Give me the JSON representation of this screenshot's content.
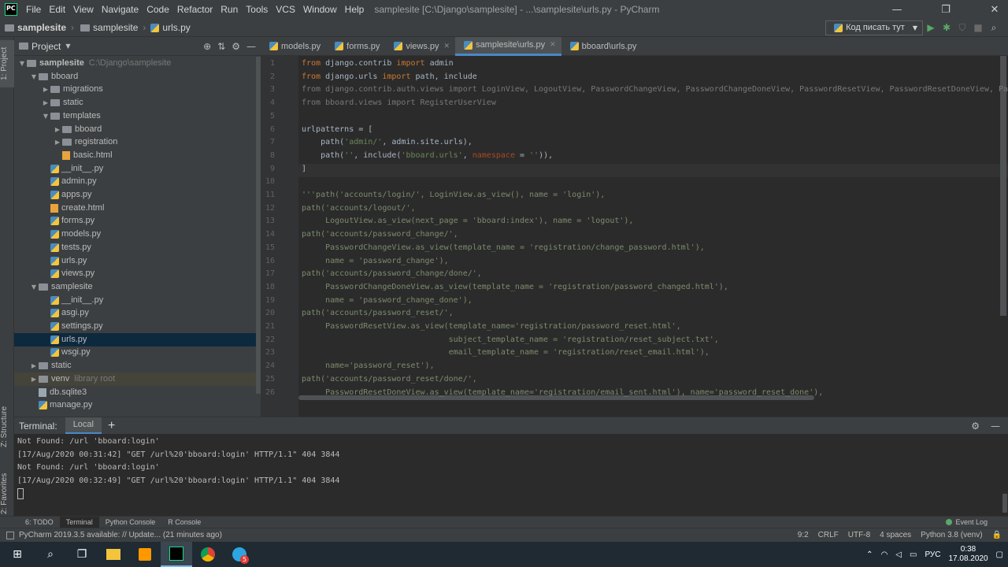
{
  "menu": [
    "File",
    "Edit",
    "View",
    "Navigate",
    "Code",
    "Refactor",
    "Run",
    "Tools",
    "VCS",
    "Window",
    "Help"
  ],
  "window_title": "samplesite [C:\\Django\\samplesite] - ...\\samplesite\\urls.py - PyCharm",
  "window_controls": {
    "minimize": "—",
    "maximize": "❐",
    "close": "✕"
  },
  "breadcrumbs": [
    "samplesite",
    "samplesite",
    "urls.py"
  ],
  "run_config": "Код писать тут",
  "left_strip": {
    "project": "1: Project",
    "structure": "Z: Structure",
    "favorites": "2: Favorites"
  },
  "project_panel": {
    "title": "Project"
  },
  "tree": [
    {
      "label": "samplesite",
      "extra": "C:\\Django\\samplesite",
      "depth": 0,
      "arrow": "▼",
      "type": "folder",
      "bold": true
    },
    {
      "label": "bboard",
      "depth": 1,
      "arrow": "▼",
      "type": "folder"
    },
    {
      "label": "migrations",
      "depth": 2,
      "arrow": "▶",
      "type": "folder"
    },
    {
      "label": "static",
      "depth": 2,
      "arrow": "▶",
      "type": "folder"
    },
    {
      "label": "templates",
      "depth": 2,
      "arrow": "▼",
      "type": "folder"
    },
    {
      "label": "bboard",
      "depth": 3,
      "arrow": "▶",
      "type": "folder"
    },
    {
      "label": "registration",
      "depth": 3,
      "arrow": "▶",
      "type": "folder"
    },
    {
      "label": "basic.html",
      "depth": 3,
      "arrow": "",
      "type": "html"
    },
    {
      "label": "__init__.py",
      "depth": 2,
      "arrow": "",
      "type": "py"
    },
    {
      "label": "admin.py",
      "depth": 2,
      "arrow": "",
      "type": "py"
    },
    {
      "label": "apps.py",
      "depth": 2,
      "arrow": "",
      "type": "py"
    },
    {
      "label": "create.html",
      "depth": 2,
      "arrow": "",
      "type": "html"
    },
    {
      "label": "forms.py",
      "depth": 2,
      "arrow": "",
      "type": "py"
    },
    {
      "label": "models.py",
      "depth": 2,
      "arrow": "",
      "type": "py"
    },
    {
      "label": "tests.py",
      "depth": 2,
      "arrow": "",
      "type": "py"
    },
    {
      "label": "urls.py",
      "depth": 2,
      "arrow": "",
      "type": "py"
    },
    {
      "label": "views.py",
      "depth": 2,
      "arrow": "",
      "type": "py"
    },
    {
      "label": "samplesite",
      "depth": 1,
      "arrow": "▼",
      "type": "folder"
    },
    {
      "label": "__init__.py",
      "depth": 2,
      "arrow": "",
      "type": "py"
    },
    {
      "label": "asgi.py",
      "depth": 2,
      "arrow": "",
      "type": "py"
    },
    {
      "label": "settings.py",
      "depth": 2,
      "arrow": "",
      "type": "py"
    },
    {
      "label": "urls.py",
      "depth": 2,
      "arrow": "",
      "type": "py",
      "selected": true
    },
    {
      "label": "wsgi.py",
      "depth": 2,
      "arrow": "",
      "type": "py"
    },
    {
      "label": "static",
      "depth": 1,
      "arrow": "▶",
      "type": "folder"
    },
    {
      "label": "venv",
      "extra": "library root",
      "depth": 1,
      "arrow": "▶",
      "type": "folder",
      "venv": true
    },
    {
      "label": "db.sqlite3",
      "depth": 1,
      "arrow": "",
      "type": "db"
    },
    {
      "label": "manage.py",
      "depth": 1,
      "arrow": "",
      "type": "py"
    }
  ],
  "editor_tabs": [
    {
      "label": "models.py",
      "active": false
    },
    {
      "label": "forms.py",
      "active": false
    },
    {
      "label": "views.py",
      "active": false,
      "closable": true
    },
    {
      "label": "samplesite\\urls.py",
      "active": true,
      "closable": true
    },
    {
      "label": "bboard\\urls.py",
      "active": false
    }
  ],
  "code_lines": [
    "from django.contrib import admin",
    "from django.urls import path, include",
    "from django.contrib.auth.views import LoginView, LogoutView, PasswordChangeView, PasswordChangeDoneView, PasswordResetView, PasswordResetDoneView, Pa",
    "from bboard.views import RegisterUserView",
    "",
    "urlpatterns = [",
    "    path('admin/', admin.site.urls),",
    "    path('', include('bboard.urls', namespace = '')),",
    "]",
    "",
    "'''path('accounts/login/', LoginView.as_view(), name = 'login'),",
    "path('accounts/logout/',",
    "     LogoutView.as_view(next_page = 'bboard:index'), name = 'logout'),",
    "path('accounts/password_change/',",
    "     PasswordChangeView.as_view(template_name = 'registration/change_password.html'),",
    "     name = 'password_change'),",
    "path('accounts/password_change/done/',",
    "     PasswordChangeDoneView.as_view(template_name = 'registration/password_changed.html'),",
    "     name = 'password_change_done'),",
    "path('accounts/password_reset/',",
    "     PasswordResetView.as_view(template_name='registration/password_reset.html',",
    "                               subject_template_name = 'registration/reset_subject.txt',",
    "                               email_template_name = 'registration/reset_email.html'),",
    "     name='password_reset'),",
    "path('accounts/password_reset/done/',",
    "     PasswordResetDoneView.as_view(template_name='registration/email_sent.html'), name='password_reset_done'),"
  ],
  "terminal": {
    "label": "Terminal:",
    "tab": "Local",
    "add": "+",
    "lines": [
      "Not Found: /url 'bboard:login'",
      "[17/Aug/2020 00:31:42] \"GET /url%20'bboard:login' HTTP/1.1\" 404 3844",
      "Not Found: /url 'bboard:login'",
      "[17/Aug/2020 00:32:49] \"GET /url%20'bboard:login' HTTP/1.1\" 404 3844"
    ]
  },
  "bottom_tabs": {
    "todo": "6: TODO",
    "terminal": "Terminal",
    "python_console": "Python Console",
    "r_console": "R Console",
    "event_log": "Event Log"
  },
  "status": {
    "message": "PyCharm 2019.3.5 available: // Update... (21 minutes ago)",
    "position": "9:2",
    "line_sep": "CRLF",
    "encoding": "UTF-8",
    "indent": "4 spaces",
    "interpreter": "Python 3.8 (venv)"
  },
  "taskbar": {
    "time": "0:38",
    "date": "17.08.2020",
    "lang": "РУС",
    "telegram_badge": "5"
  }
}
